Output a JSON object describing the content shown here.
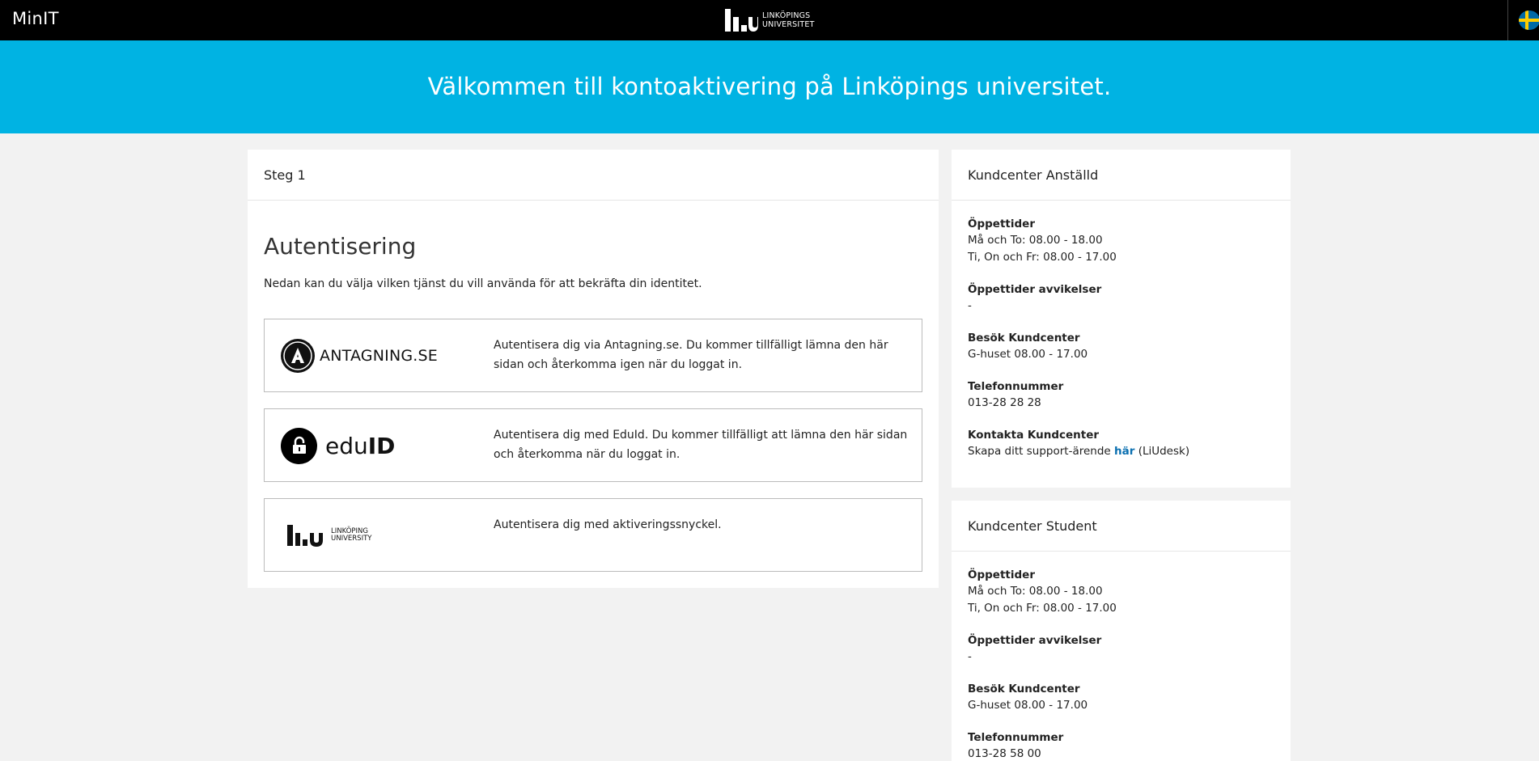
{
  "topbar": {
    "app_name": "MinIT",
    "logo_line1": "LINKÖPINGS",
    "logo_line2": "UNIVERSITET",
    "language_flag": "swedish-flag-icon"
  },
  "banner": {
    "title": "Välkommen till kontoaktivering på Linköpings universitet."
  },
  "main": {
    "step_label": "Steg 1",
    "heading": "Autentisering",
    "intro": "Nedan kan du välja vilken tjänst du vill använda för att bekräfta din identitet.",
    "options": [
      {
        "logo_text": "ANTAGNING.SE",
        "description": "Autentisera dig via Antagning.se. Du kommer tillfälligt lämna den här sidan och återkomma igen när du loggat in."
      },
      {
        "logo_text_light": "edu",
        "logo_text_bold": "ID",
        "description": "Autentisera dig med EduId. Du kommer tillfälligt att lämna den här sidan och återkomma när du loggat in."
      },
      {
        "logo_line1": "LINKÖPING",
        "logo_line2": "UNIVERSITY",
        "description": "Autentisera dig med aktiveringssnyckel."
      }
    ]
  },
  "staff": {
    "title": "Kundcenter Anställd",
    "hours_title": "Öppettider",
    "hours_line1": "Må och To: 08.00 - 18.00",
    "hours_line2": "Ti, On och Fr: 08.00 - 17.00",
    "deviations_title": "Öppettider avvikelser",
    "deviations_value": "-",
    "visit_title": "Besök Kundcenter",
    "visit_value": "G-huset 08.00 - 17.00",
    "phone_title": "Telefonnummer",
    "phone_value": "013-28 28 28",
    "contact_title": "Kontakta Kundcenter",
    "contact_prefix": "Skapa ditt support-ärende ",
    "contact_link": "här",
    "contact_suffix": " (LiUdesk)"
  },
  "student": {
    "title": "Kundcenter Student",
    "hours_title": "Öppettider",
    "hours_line1": "Må och To: 08.00 - 18.00",
    "hours_line2": "Ti, On och Fr: 08.00 - 17.00",
    "deviations_title": "Öppettider avvikelser",
    "deviations_value": "-",
    "visit_title": "Besök Kundcenter",
    "visit_value": "G-huset 08.00 - 17.00",
    "phone_title": "Telefonnummer",
    "phone_value": "013-28 58 00"
  }
}
